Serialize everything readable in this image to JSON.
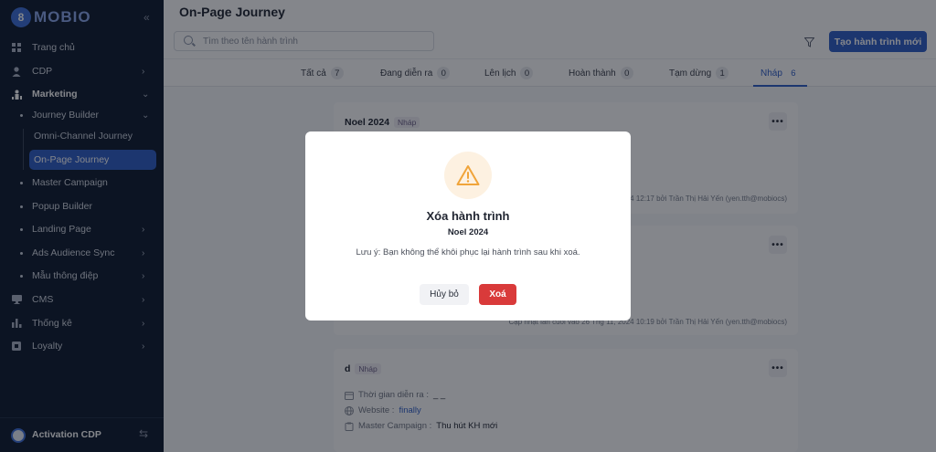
{
  "brand": {
    "logo_text": "MOBIO",
    "logo_letter": "8"
  },
  "sidebar": {
    "collapse_icon": "double-chevron-left-icon",
    "items": [
      {
        "label": "Trang chủ",
        "icon": "grid-icon"
      },
      {
        "label": "CDP",
        "icon": "user-icon"
      },
      {
        "label": "Marketing",
        "icon": "person-up-icon"
      },
      {
        "label": "Journey Builder"
      },
      {
        "label": "Omni-Channel Journey"
      },
      {
        "label": "On-Page Journey"
      },
      {
        "label": "Master Campaign"
      },
      {
        "label": "Popup Builder"
      },
      {
        "label": "Landing Page"
      },
      {
        "label": "Ads Audience Sync"
      },
      {
        "label": "Mẫu thông điệp"
      },
      {
        "label": "CMS",
        "icon": "monitor-icon"
      },
      {
        "label": "Thống kê",
        "icon": "bar-chart-icon"
      },
      {
        "label": "Loyalty",
        "icon": "card-icon"
      }
    ],
    "footer": {
      "label": "Activation CDP"
    }
  },
  "header": {
    "title": "On-Page Journey",
    "search_placeholder": "Tìm theo tên hành trình",
    "new_button": "Tạo hành trình mới"
  },
  "tabs": [
    {
      "label": "Tất cả",
      "count": "7"
    },
    {
      "label": "Đang diễn ra",
      "count": "0"
    },
    {
      "label": "Lên lịch",
      "count": "0"
    },
    {
      "label": "Hoàn thành",
      "count": "0"
    },
    {
      "label": "Tạm dừng",
      "count": "1"
    },
    {
      "label": "Nháp",
      "count": "6"
    }
  ],
  "cards": [
    {
      "title": "Noel 2024",
      "status": "Nháp",
      "updated": "2024 12:17 bởi Trần Thị Hải Yến (yen.tth@mobiocs)"
    },
    {
      "updated": "Cập nhật lần cuối vào 26 Thg 11, 2024 10:19 bởi Trần Thị Hải Yến (yen.tth@mobiocs)"
    },
    {
      "title": "d",
      "status": "Nháp",
      "time_label": "Thời gian diễn ra :",
      "time_value": "_ _",
      "website_label": "Website :",
      "website_value": "finally",
      "campaign_label": "Master Campaign :",
      "campaign_value": "Thu hút KH mới"
    }
  ],
  "more_button": "•••",
  "modal": {
    "icon": "warning-icon",
    "title": "Xóa hành trình",
    "subtitle": "Noel 2024",
    "note": "Lưu ý: Bạn không thể khôi phục lại hành trình sau khi xoá.",
    "cancel": "Hủy bỏ",
    "delete": "Xoá"
  },
  "colors": {
    "accent": "#2f5ec7",
    "danger": "#d93a3a",
    "sidebar_bg": "#0f1b2e",
    "warning": "#f0a43a"
  }
}
